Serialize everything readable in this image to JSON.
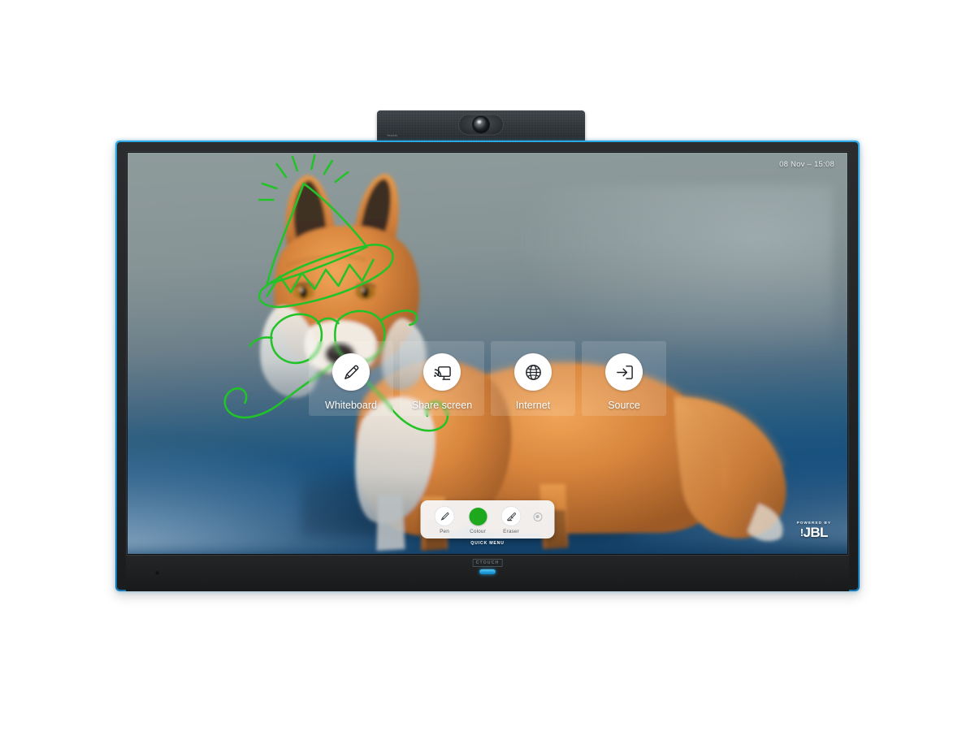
{
  "device": {
    "brand_logo": "CTOUCH",
    "camera_brand": "Yealink",
    "camera_icon": "camera-lens-icon",
    "accent_color": "#1e9fdc",
    "bezel_color": "#222426"
  },
  "screen": {
    "status_bar": {
      "datetime": "08 Nov – 15:08"
    },
    "wallpaper": {
      "subject": "red fox standing in snow",
      "sky_color": "#8b9899",
      "snow_color": "#174e7c",
      "fur_color": "#d98a43"
    },
    "annotation": {
      "tool": "pen",
      "stroke_color": "#22c328",
      "stroke_width": 2.4,
      "drawings": [
        "party hat",
        "sparkle lines",
        "eyeglasses",
        "curly moustache"
      ]
    },
    "branding": {
      "powered_by": "POWERED BY",
      "partner": "JBL",
      "partner_prefix": "!"
    },
    "launcher": {
      "tiles": [
        {
          "label": "Whiteboard",
          "icon": "pencil-icon"
        },
        {
          "label": "Share screen",
          "icon": "screen-cast-icon"
        },
        {
          "label": "Internet",
          "icon": "globe-icon"
        },
        {
          "label": "Source",
          "icon": "input-source-icon"
        }
      ]
    },
    "quick_menu": {
      "caption": "QUICK MENU",
      "items": [
        {
          "label": "Pen",
          "icon": "pen-icon",
          "type": "tool"
        },
        {
          "label": "Colour",
          "icon": "color-swatch",
          "type": "swatch",
          "value": "#1ea81e"
        },
        {
          "label": "Eraser",
          "icon": "eraser-icon",
          "type": "tool"
        }
      ],
      "more_button": {
        "icon": "more-options-icon",
        "label": ""
      }
    }
  }
}
